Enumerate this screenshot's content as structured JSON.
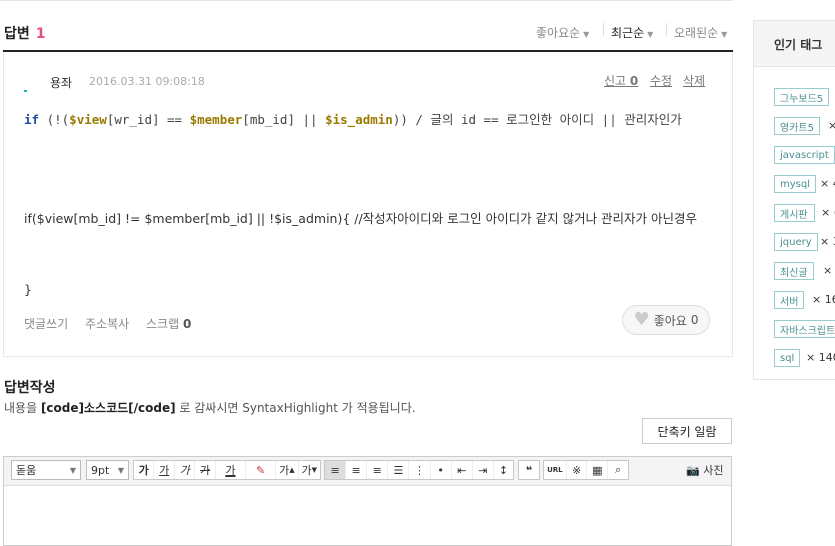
{
  "answers": {
    "title": "답변",
    "count": "1",
    "sort": [
      "좋아요순",
      "최근순",
      "오래된순"
    ]
  },
  "answer": {
    "author": "용좌",
    "date": "2016.03.31 09:08:18",
    "actions": {
      "report_label": "신고",
      "report_count": "0",
      "edit": "수정",
      "delete": "삭제"
    },
    "code": {
      "l1_if": "if",
      "l1_p1": " (!(",
      "l1_v1": "$view",
      "l1_p2": "[wr_id] == ",
      "l1_v2": "$member",
      "l1_p3": "[mb_id] || ",
      "l1_v3": "$is_admin",
      "l1_p4": "))  / 글의 id == 로그인한 아이디 || 관리자인가",
      "line2": "if($view[mb_id] != $member[mb_id] || !$is_admin){ //작성자아이디와 로그인 아이디가 같지 않거나 관리자가 아닌경우",
      "line3": "}"
    },
    "footer": {
      "comment": "댓글쓰기",
      "copy": "주소복사",
      "scrap": "스크랩",
      "scrap_count": "0"
    },
    "like": {
      "label": "좋아요",
      "count": "0"
    }
  },
  "write": {
    "title": "답변작성",
    "hint_pre": "내용을 ",
    "hint_code": "[code]소스코드[/code]",
    "hint_post": " 로 감싸시면 SyntaxHighlight 가 적용됩니다.",
    "shortcut": "단축키 일람"
  },
  "editor": {
    "font": "돋움",
    "size": "9pt",
    "format": [
      "가",
      "가",
      "가",
      "가",
      "가",
      "가"
    ],
    "superscript": "가",
    "subscript": "가",
    "url": "URL",
    "special_char": "※",
    "photo": "사진"
  },
  "sidebar": {
    "title": "인기 태그",
    "tags": [
      {
        "name": "그누보드5",
        "count": ""
      },
      {
        "name": "영카트5",
        "count": "×"
      },
      {
        "name": "javascript",
        "count": ""
      },
      {
        "name": "mysql",
        "count": "× 4"
      },
      {
        "name": "게시판",
        "count": "× ("
      },
      {
        "name": "jquery",
        "count": "× 3"
      },
      {
        "name": "최신글",
        "count": "×"
      },
      {
        "name": "서버",
        "count": "× 16"
      },
      {
        "name": "자바스크립트",
        "count": ""
      },
      {
        "name": "sql",
        "count": "× 140"
      }
    ]
  }
}
